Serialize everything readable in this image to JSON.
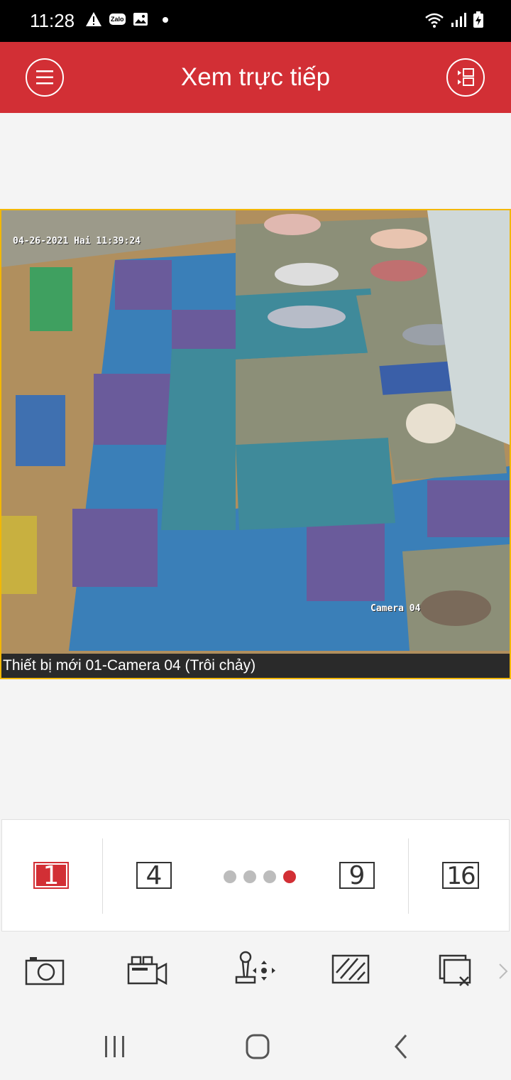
{
  "status_bar": {
    "time": "11:28",
    "notification_icons": [
      "warning-icon",
      "zalo-icon",
      "image-icon",
      "dot-icon"
    ],
    "zalo_label": "Zalo",
    "system_icons": [
      "wifi-icon",
      "signal-icon",
      "battery-charging-icon"
    ]
  },
  "header": {
    "title": "Xem trực tiếp",
    "left_icon": "menu-icon",
    "right_icon": "channel-list-icon",
    "color": "#d22f35"
  },
  "video": {
    "osd_datetime": "04-26-2021 Hai 11:39:24",
    "osd_camera": "Camera 04",
    "caption": "Thiết bị mới 01-Camera 04 (Trôi chảy)",
    "selected_border_color": "#f2b705"
  },
  "layout_selector": {
    "options": [
      {
        "label": "1",
        "active": true
      },
      {
        "label": "4",
        "active": false
      },
      {
        "label": "9",
        "active": false
      },
      {
        "label": "16",
        "active": false
      }
    ],
    "page_indicator": {
      "count": 4,
      "active_index": 3
    }
  },
  "toolbar": {
    "tools": [
      "camera-snapshot-icon",
      "video-record-icon",
      "ptz-control-icon",
      "image-quality-icon",
      "close-window-icon"
    ],
    "more_icon": "chevron-right-icon"
  },
  "nav_bar": {
    "buttons": [
      "recent-apps-icon",
      "home-icon",
      "back-icon"
    ]
  }
}
